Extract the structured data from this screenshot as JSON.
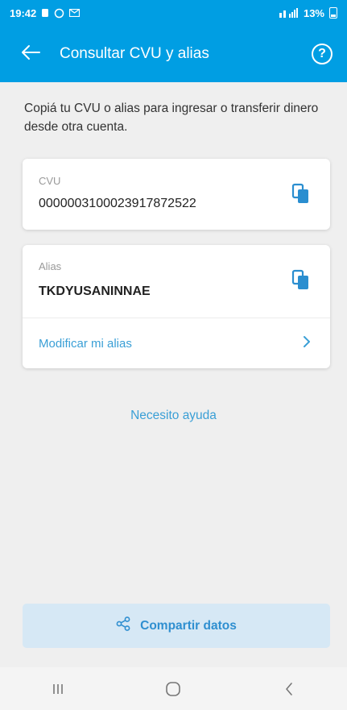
{
  "status_bar": {
    "time": "19:42",
    "battery_text": "13%"
  },
  "app_bar": {
    "title": "Consultar CVU y alias",
    "help_glyph": "?"
  },
  "intro_text": "Copiá tu CVU o alias para ingresar o transferir dinero desde otra cuenta.",
  "cvu_card": {
    "label": "CVU",
    "value": "0000003100023917872522"
  },
  "alias_card": {
    "label": "Alias",
    "value": "TKDYUSANINNAE",
    "modify_label": "Modificar mi alias"
  },
  "help_link": "Necesito ayuda",
  "share_button": {
    "label": "Compartir datos"
  },
  "colors": {
    "brand": "#009ee3",
    "link": "#3a9fd6",
    "share_bg": "#d6e8f5"
  },
  "icons": {
    "back": "arrow-left-icon",
    "help": "question-circle-icon",
    "copy": "copy-icon",
    "chevron": "chevron-right-icon",
    "share": "share-icon"
  }
}
